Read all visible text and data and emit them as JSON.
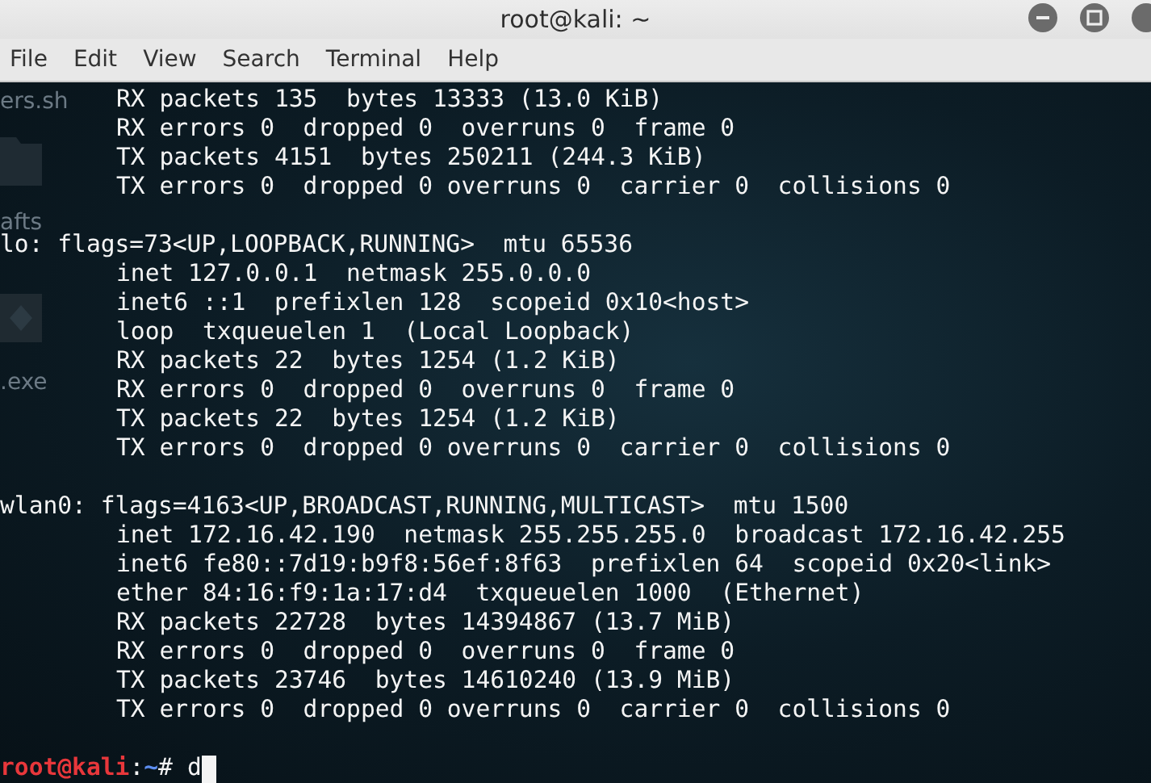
{
  "window": {
    "title": "root@kali: ~"
  },
  "menu": [
    "File",
    "Edit",
    "View",
    "Search",
    "Terminal",
    "Help"
  ],
  "desktop_labels": [
    "ers.sh",
    "afts",
    ".exe"
  ],
  "blocks": [
    {
      "lines": [
        "RX packets 135  bytes 13333 (13.0 KiB)",
        "RX errors 0  dropped 0  overruns 0  frame 0",
        "TX packets 4151  bytes 250211 (244.3 KiB)",
        "TX errors 0  dropped 0 overruns 0  carrier 0  collisions 0"
      ]
    },
    {
      "header": "lo: flags=73<UP,LOOPBACK,RUNNING>  mtu 65536",
      "lines": [
        "inet 127.0.0.1  netmask 255.0.0.0",
        "inet6 ::1  prefixlen 128  scopeid 0x10<host>",
        "loop  txqueuelen 1  (Local Loopback)",
        "RX packets 22  bytes 1254 (1.2 KiB)",
        "RX errors 0  dropped 0  overruns 0  frame 0",
        "TX packets 22  bytes 1254 (1.2 KiB)",
        "TX errors 0  dropped 0 overruns 0  carrier 0  collisions 0"
      ]
    },
    {
      "header": "wlan0: flags=4163<UP,BROADCAST,RUNNING,MULTICAST>  mtu 1500",
      "lines": [
        "inet 172.16.42.190  netmask 255.255.255.0  broadcast 172.16.42.255",
        "inet6 fe80::7d19:b9f8:56ef:8f63  prefixlen 64  scopeid 0x20<link>",
        "ether 84:16:f9:1a:17:d4  txqueuelen 1000  (Ethernet)",
        "RX packets 22728  bytes 14394867 (13.7 MiB)",
        "RX errors 0  dropped 0  overruns 0  frame 0",
        "TX packets 23746  bytes 14610240 (13.9 MiB)",
        "TX errors 0  dropped 0 overruns 0  carrier 0  collisions 0"
      ]
    }
  ],
  "prompt": {
    "user_host": "root@kali",
    "separator": ":",
    "path": "~",
    "symbol": "#",
    "input": "d"
  }
}
